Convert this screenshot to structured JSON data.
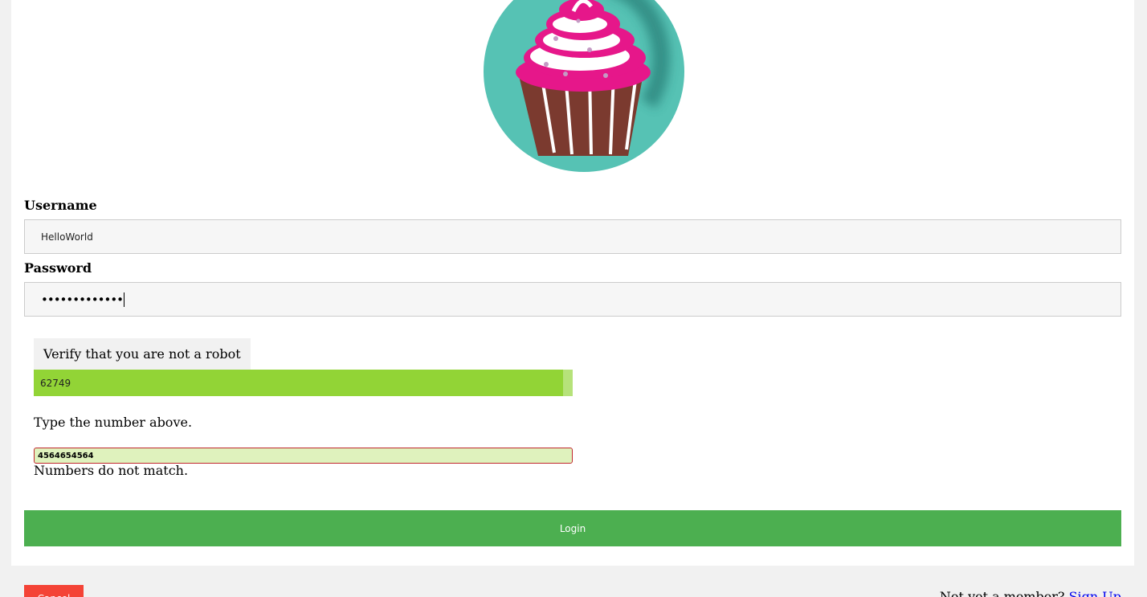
{
  "form": {
    "username_label": "Username",
    "username_value": "HelloWorld",
    "password_label": "Password",
    "password_masked": "•••••••••••••",
    "login_label": "Login"
  },
  "captcha": {
    "title": "Verify that you are not a robot",
    "code": "62749",
    "hint": "Type the number above.",
    "input_value": "4564654564",
    "error": "Numbers do not match."
  },
  "footer": {
    "cancel_label": "Cancel",
    "signup_prompt": "Not yet a member?",
    "signup_link": "Sign Up"
  },
  "colors": {
    "login": "#4caf50",
    "cancel": "#f44336",
    "captcha_code_bg": "#92d436",
    "captcha_input_bg": "#dff2bd",
    "captcha_input_border": "#c0282d",
    "avatar_bg": "#56c2b4",
    "frosting": "#e6178a",
    "cup": "#7b3a2f"
  },
  "icons": {
    "avatar": "cupcake-avatar"
  }
}
